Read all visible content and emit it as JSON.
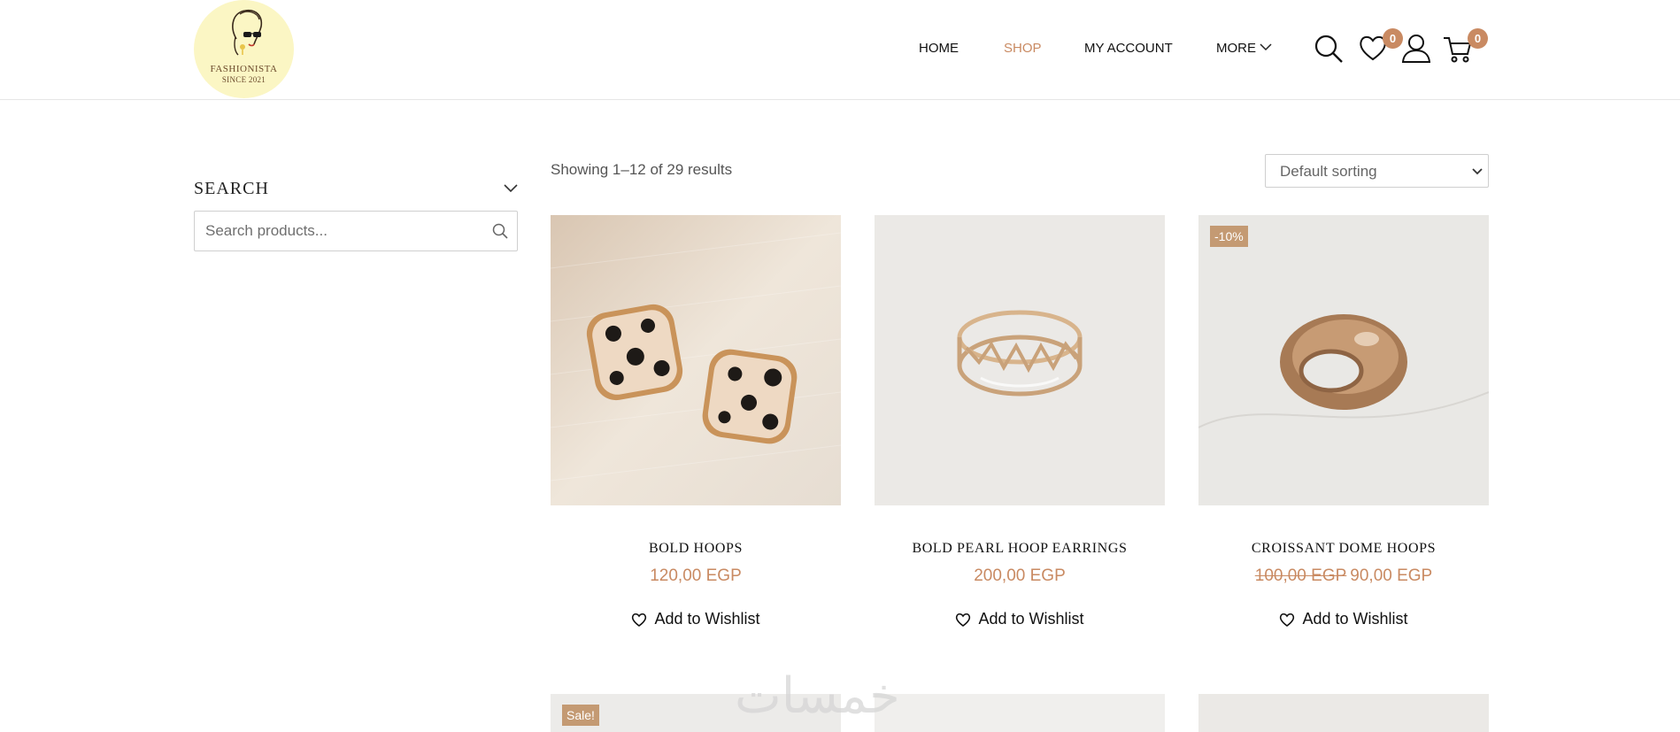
{
  "brand": {
    "line1": "FASHIONISTA",
    "line2": "SINCE 2021"
  },
  "nav": {
    "home": "HOME",
    "shop": "SHOP",
    "account": "MY ACCOUNT",
    "more": "MORE"
  },
  "header_icons": {
    "wishlist_count": "0",
    "cart_count": "0"
  },
  "sidebar": {
    "search_title": "SEARCH",
    "search_placeholder": "Search products..."
  },
  "toolbar": {
    "result_count": "Showing 1–12 of 29 results",
    "sort_selected": "Default sorting"
  },
  "products": [
    {
      "name": "BOLD HOOPS",
      "price": "120,00 EGP",
      "old_price": "",
      "badge": "",
      "wishlist": "Add to Wishlist"
    },
    {
      "name": "BOLD PEARL HOOP EARRINGS",
      "price": "200,00 EGP",
      "old_price": "",
      "badge": "",
      "wishlist": "Add to Wishlist"
    },
    {
      "name": "CROISSANT DOME HOOPS",
      "price": "90,00 EGP",
      "old_price": "100,00 EGP",
      "badge": "-10%",
      "wishlist": "Add to Wishlist"
    }
  ],
  "row2": {
    "first_badge": "Sale!"
  },
  "watermark": "خمسات",
  "colors": {
    "accent": "#c98a62",
    "badge_bg": "#c49a73",
    "logo_bg": "#fbf6c4"
  }
}
